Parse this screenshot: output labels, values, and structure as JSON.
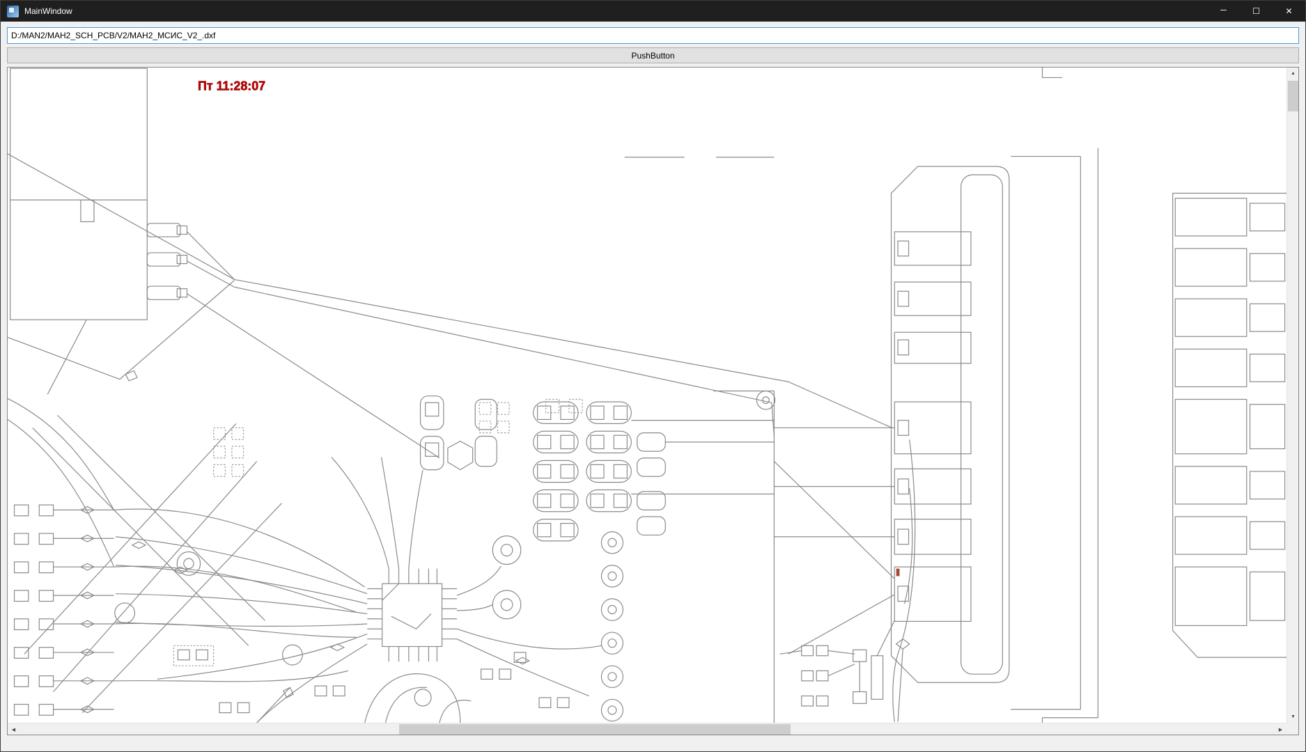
{
  "window": {
    "title": "MainWindow"
  },
  "titlebar": {
    "minimize_glyph": "─",
    "maximize_glyph": "☐",
    "close_glyph": "✕"
  },
  "form": {
    "path_input_value": "D:/MAN2/MAH2_SCH_PCB/V2/MAH2_МСИС_V2_.dxf",
    "push_button_label": "PushButton"
  },
  "canvas": {
    "timestamp_text": "Пт 11:28:07",
    "timestamp_color": "#cc0000"
  },
  "scrollbars": {
    "up_arrow": "▲",
    "down_arrow": "▼",
    "left_arrow": "◀",
    "right_arrow": "▶"
  },
  "colors": {
    "titlebar_bg": "#1f1f1f",
    "window_bg": "#f0f0f0",
    "input_focus_border": "#4a9ade",
    "drawing_line": "#8a8a8a"
  }
}
